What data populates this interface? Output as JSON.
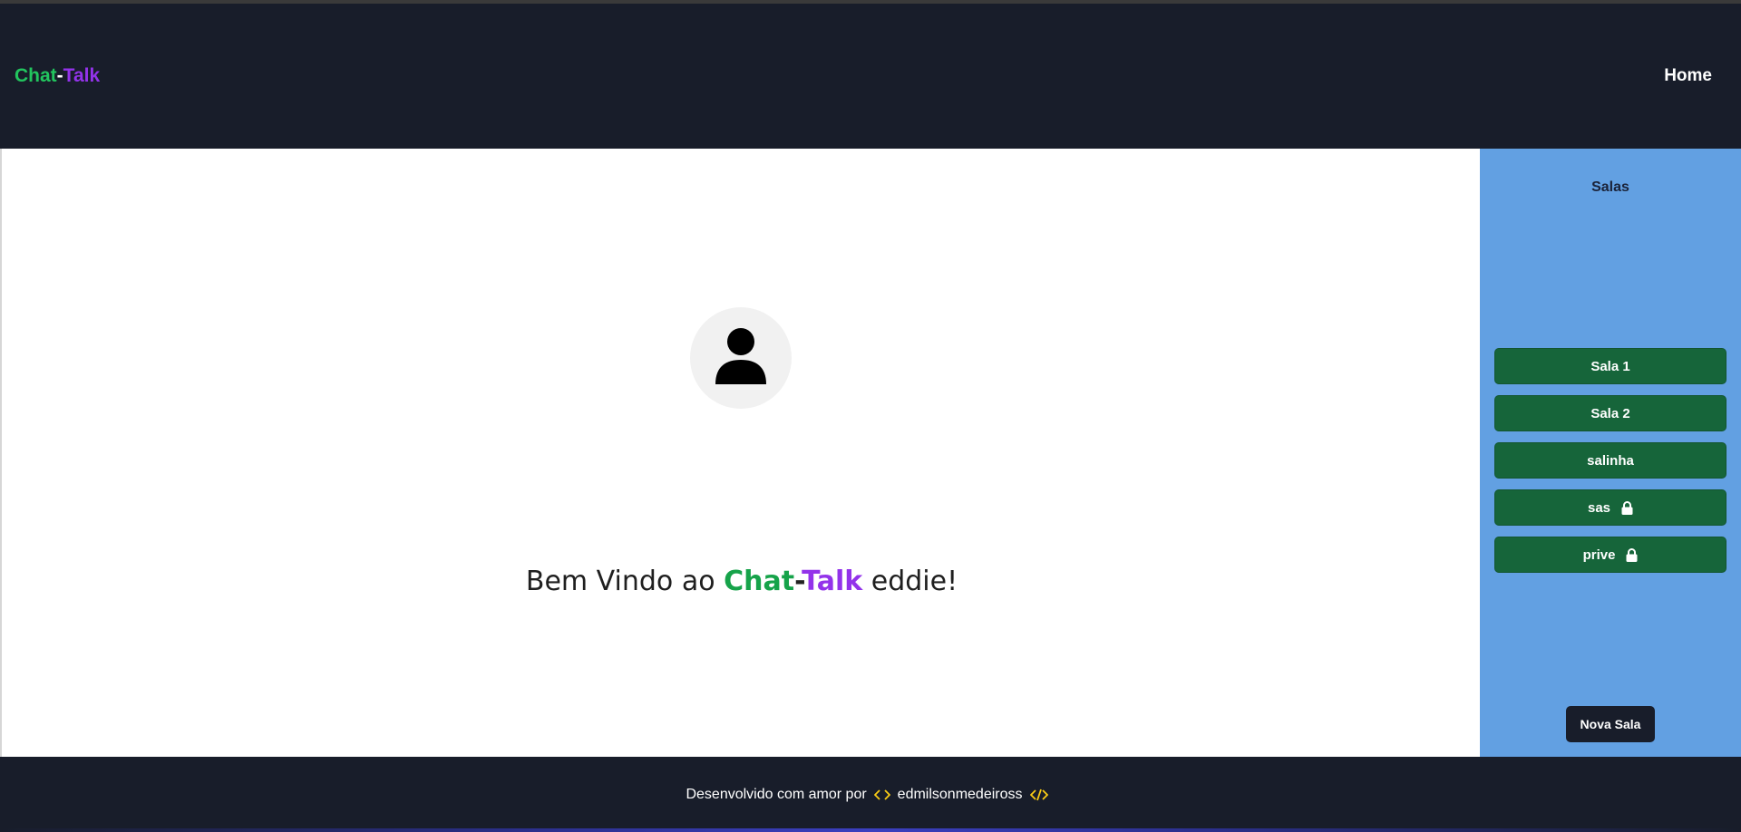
{
  "brand": {
    "part1": "Chat",
    "separator": "-",
    "part2": "Talk"
  },
  "nav": {
    "home_label": "Home"
  },
  "welcome": {
    "prefix": "Bem Vindo ao",
    "brand_part1": "Chat",
    "brand_separator": "-",
    "brand_part2": "Talk",
    "username_suffix": "eddie!"
  },
  "sidebar": {
    "title": "Salas",
    "rooms": [
      {
        "label": "Sala 1",
        "locked": false
      },
      {
        "label": "Sala 2",
        "locked": false
      },
      {
        "label": "salinha",
        "locked": false
      },
      {
        "label": "sas",
        "locked": true,
        "icon": "lock-icon"
      },
      {
        "label": "prive",
        "locked": true,
        "icon": "lock-icon"
      }
    ],
    "new_room_label": "Nova Sala"
  },
  "footer": {
    "text": "Desenvolvido com amor por",
    "author": "edmilsonmedeiross",
    "icon_open": "code-icon",
    "icon_close": "code-slash-icon"
  },
  "colors": {
    "navbar": "#181d2a",
    "sidebar": "#62a0e2",
    "room_button": "#16653a",
    "brand_green": "#22c55e",
    "brand_purple": "#9333ea",
    "footer_icon": "#facc15"
  }
}
